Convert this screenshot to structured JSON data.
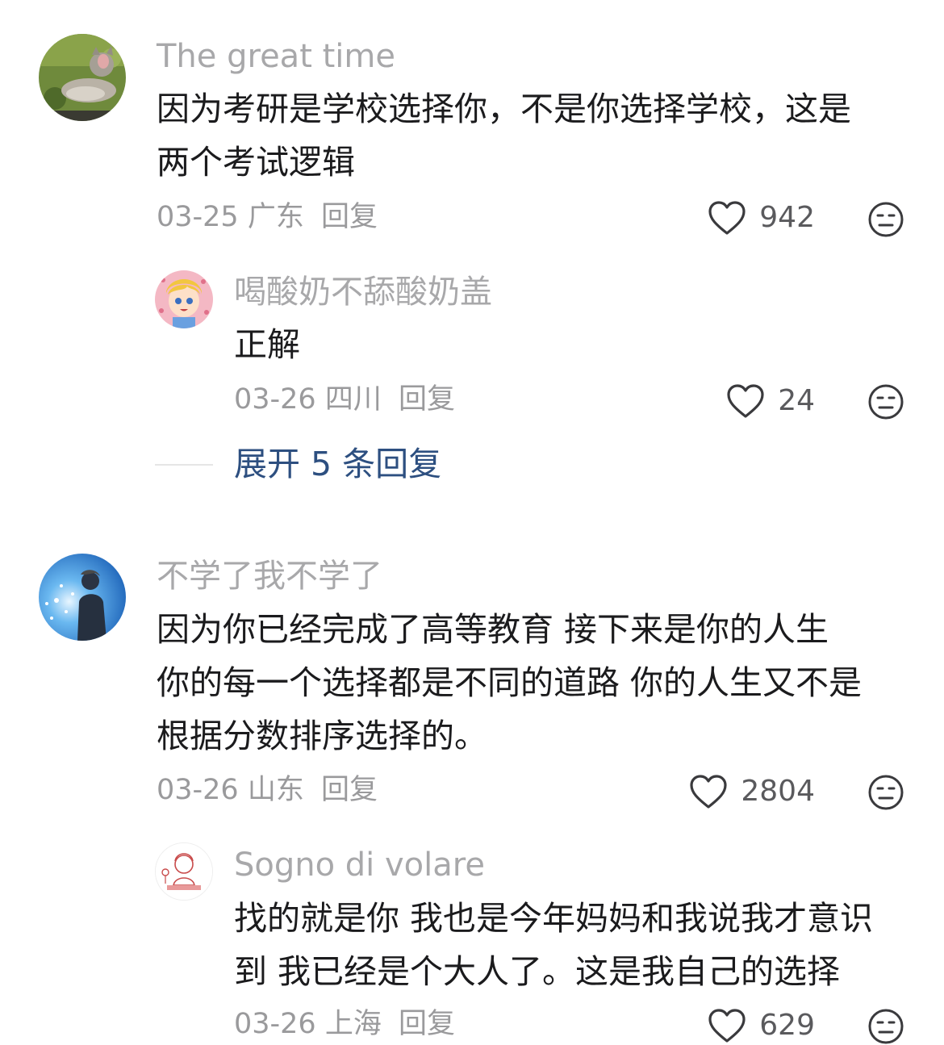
{
  "comments": [
    {
      "username": "The great time",
      "lines": [
        "因为考研是学校选择你，不是你选择学校，这是",
        "两个考试逻辑"
      ],
      "date": "03-25",
      "region": "广东",
      "reply_label": "回复",
      "likes": "942",
      "replies": [
        {
          "username": "喝酸奶不舔酸奶盖",
          "lines": [
            "正解"
          ],
          "date": "03-26",
          "region": "四川",
          "reply_label": "回复",
          "likes": "24"
        }
      ],
      "expand_label": "展开 5 条回复"
    },
    {
      "username": "不学了我不学了",
      "lines": [
        "因为你已经完成了高等教育  接下来是你的人生",
        "你的每一个选择都是不同的道路  你的人生又不是",
        "根据分数排序选择的。"
      ],
      "date": "03-26",
      "region": "山东",
      "reply_label": "回复",
      "likes": "2804",
      "replies": [
        {
          "username": "Sogno di volare",
          "lines": [
            "找的就是你 我也是今年妈妈和我说我才意识",
            "到 我已经是个大人了。这是我自己的选择"
          ],
          "date": "03-26",
          "region": "上海",
          "reply_label": "回复",
          "likes": "629"
        }
      ]
    }
  ],
  "icons": {
    "like": "heart-outline-icon",
    "dislike": "neutral-face-icon"
  },
  "colors": {
    "username": "#a8a8aa",
    "text": "#1b1b1d",
    "meta": "#9a9a9c",
    "link": "#2d4f80"
  }
}
